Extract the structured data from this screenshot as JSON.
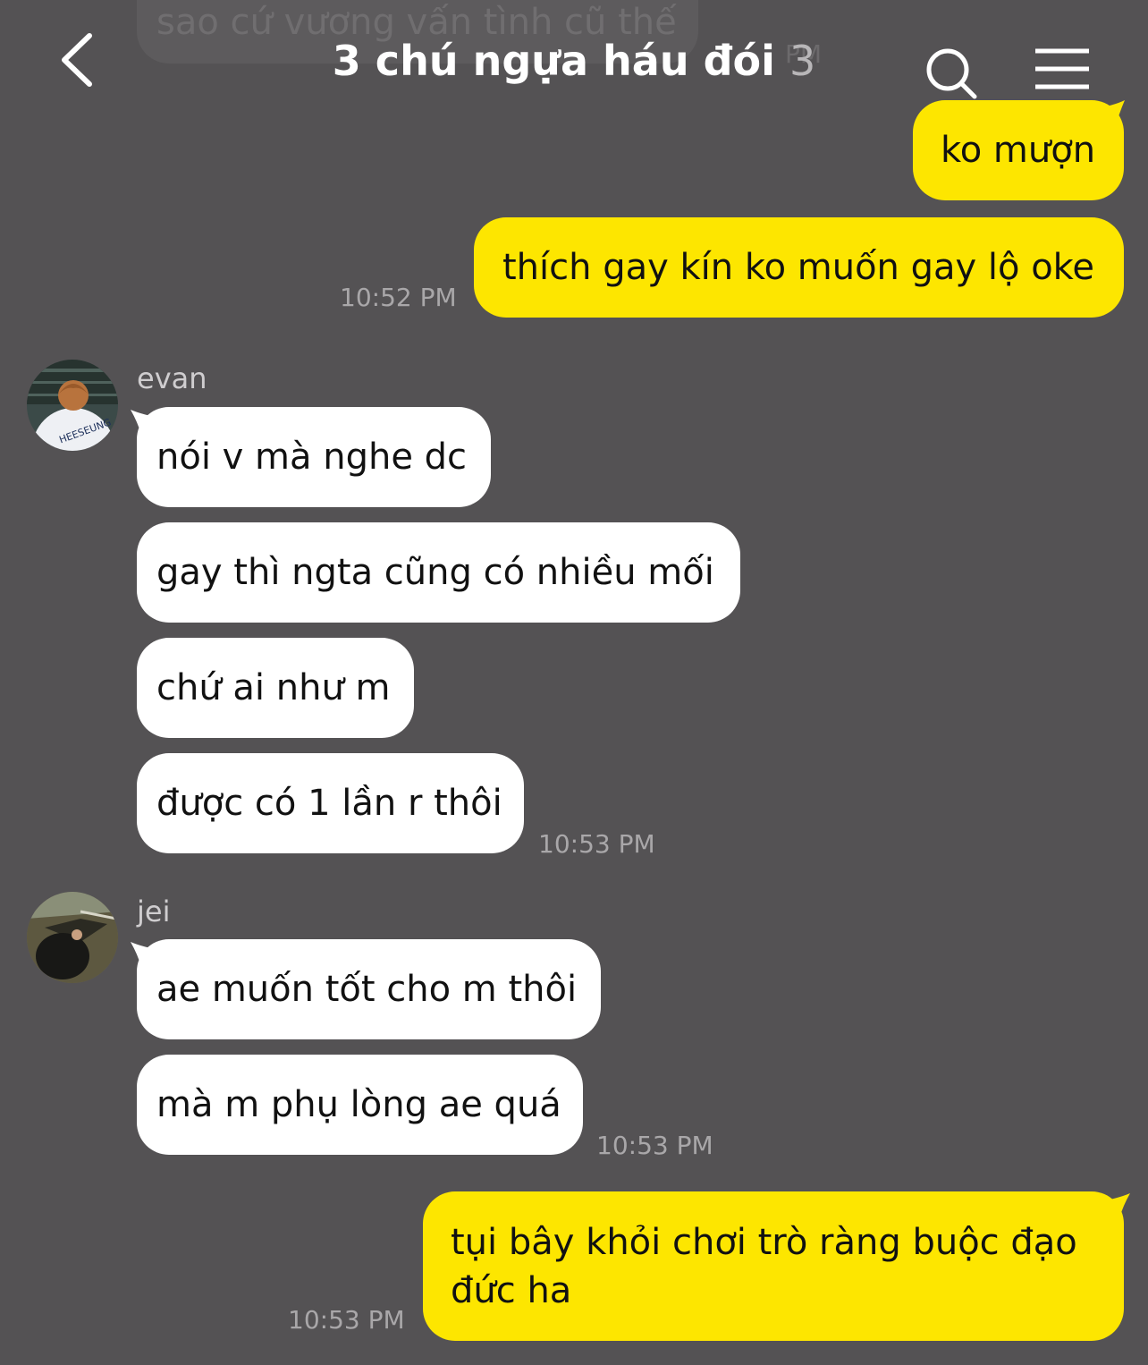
{
  "header": {
    "title": "3 chú ngựa háu đói",
    "member_count": "3",
    "behind_time": "PM",
    "back_icon": "chevron-left-icon",
    "search_icon": "search-icon",
    "menu_icon": "hamburger-menu-icon"
  },
  "top_partial_message": {
    "text": "sao cứ vương vấn tình cũ thế"
  },
  "messages": [
    {
      "direction": "out",
      "text": "ko mượn"
    },
    {
      "direction": "out",
      "text": "thích gay kín ko muốn gay lộ oke",
      "time": "10:52 PM"
    },
    {
      "direction": "in",
      "sender": "evan",
      "text": "nói v mà nghe dc"
    },
    {
      "direction": "in",
      "sender": "evan",
      "text": "gay thì ngta cũng có nhiều mối"
    },
    {
      "direction": "in",
      "sender": "evan",
      "text": "chứ ai như m"
    },
    {
      "direction": "in",
      "sender": "evan",
      "text": "được có 1 lần r thôi",
      "time": "10:53 PM"
    },
    {
      "direction": "in",
      "sender": "jei",
      "text": "ae muốn tốt cho m thôi"
    },
    {
      "direction": "in",
      "sender": "jei",
      "text": "mà m phụ lòng ae quá",
      "time": "10:53 PM"
    },
    {
      "direction": "out",
      "text_line1": "tụi bây khỏi chơi trò ràng buộc đạo",
      "text_line2": "đức ha",
      "time": "10:53 PM"
    }
  ],
  "colors": {
    "background": "#545254",
    "outgoing_bubble": "#fde600",
    "incoming_bubble": "#ffffff",
    "timestamp": "#a9a7a9"
  }
}
